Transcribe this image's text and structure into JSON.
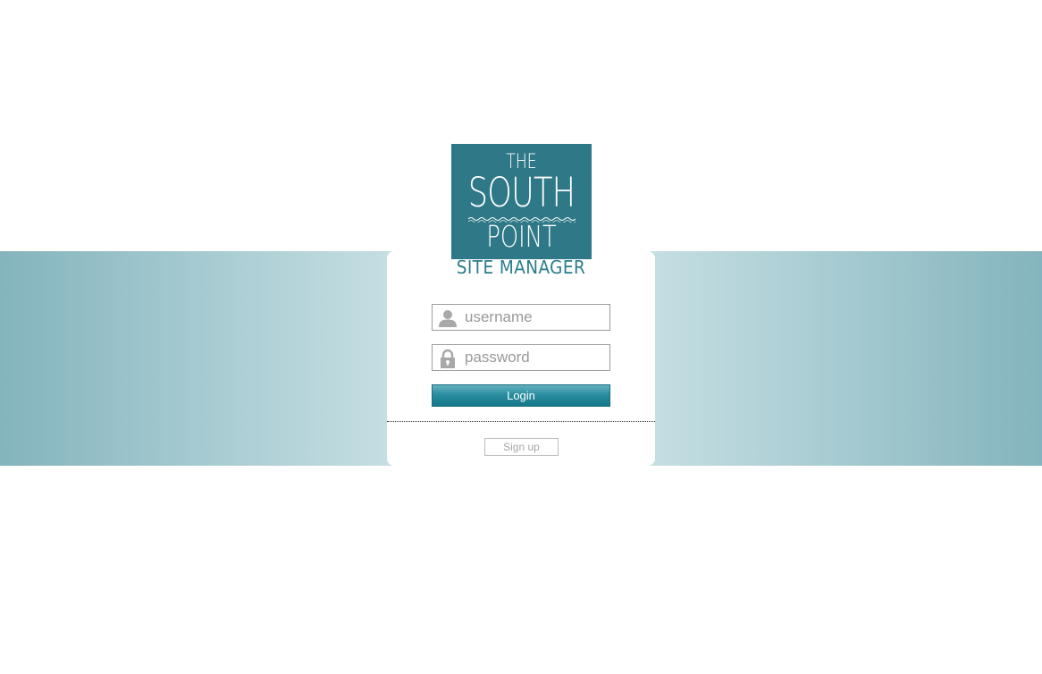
{
  "logo": {
    "line1": "THE",
    "line2": "SOUTH",
    "line3": "POINT",
    "background_color": "#2e7887"
  },
  "subtitle": "SITE MANAGER",
  "form": {
    "username": {
      "value": "",
      "placeholder": "username",
      "icon": "user-icon"
    },
    "password": {
      "value": "",
      "placeholder": "password",
      "icon": "lock-icon"
    },
    "login_label": "Login",
    "signup_label": "Sign up"
  },
  "colors": {
    "accent": "#2a7c8c",
    "band_edge": "#84b4bd",
    "band_center": "#c4dee2",
    "button_top": "#66b0bf",
    "button_bottom": "#157889"
  }
}
